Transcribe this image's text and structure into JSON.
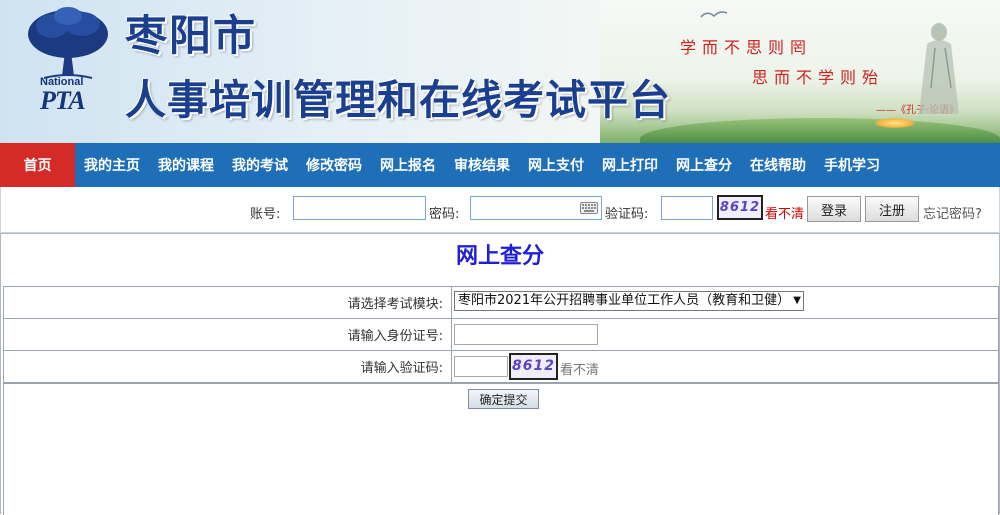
{
  "banner": {
    "logo_text_top": "National",
    "logo_text_bottom": "PTA",
    "title_city": "枣阳市",
    "title_main": "人事培训管理和在线考试平台",
    "quote_line1": "学而不思则罔",
    "quote_line2": "思而不学则殆",
    "quote_source": "——《孔子·论语》"
  },
  "nav": {
    "items": [
      {
        "label": "首页",
        "active": true
      },
      {
        "label": "我的主页"
      },
      {
        "label": "我的课程"
      },
      {
        "label": "我的考试"
      },
      {
        "label": "修改密码"
      },
      {
        "label": "网上报名"
      },
      {
        "label": "审核结果"
      },
      {
        "label": "网上支付"
      },
      {
        "label": "网上打印"
      },
      {
        "label": "网上查分"
      },
      {
        "label": "在线帮助"
      },
      {
        "label": "手机学习"
      }
    ]
  },
  "login": {
    "account_label": "账号:",
    "password_label": "密码:",
    "captcha_label": "验证码:",
    "captcha_text": "8612",
    "captcha_refresh": "看不清",
    "login_button": "登录",
    "register_button": "注册",
    "forgot_link": "忘记密码?"
  },
  "score_query": {
    "title": "网上查分",
    "exam_module_label": "请选择考试模块:",
    "exam_module_selected": "枣阳市2021年公开招聘事业单位工作人员（教育和卫健）",
    "id_label": "请输入身份证号:",
    "captcha_label": "请输入验证码:",
    "captcha_text": "8612",
    "captcha_refresh": "看不清",
    "submit_button": "确定提交"
  },
  "colors": {
    "nav_bg": "#1e6fb8",
    "nav_active": "#d42b26",
    "title_blue": "#1a3f8f",
    "panel_title": "#1f1fd6",
    "quote_red": "#d0211f"
  }
}
